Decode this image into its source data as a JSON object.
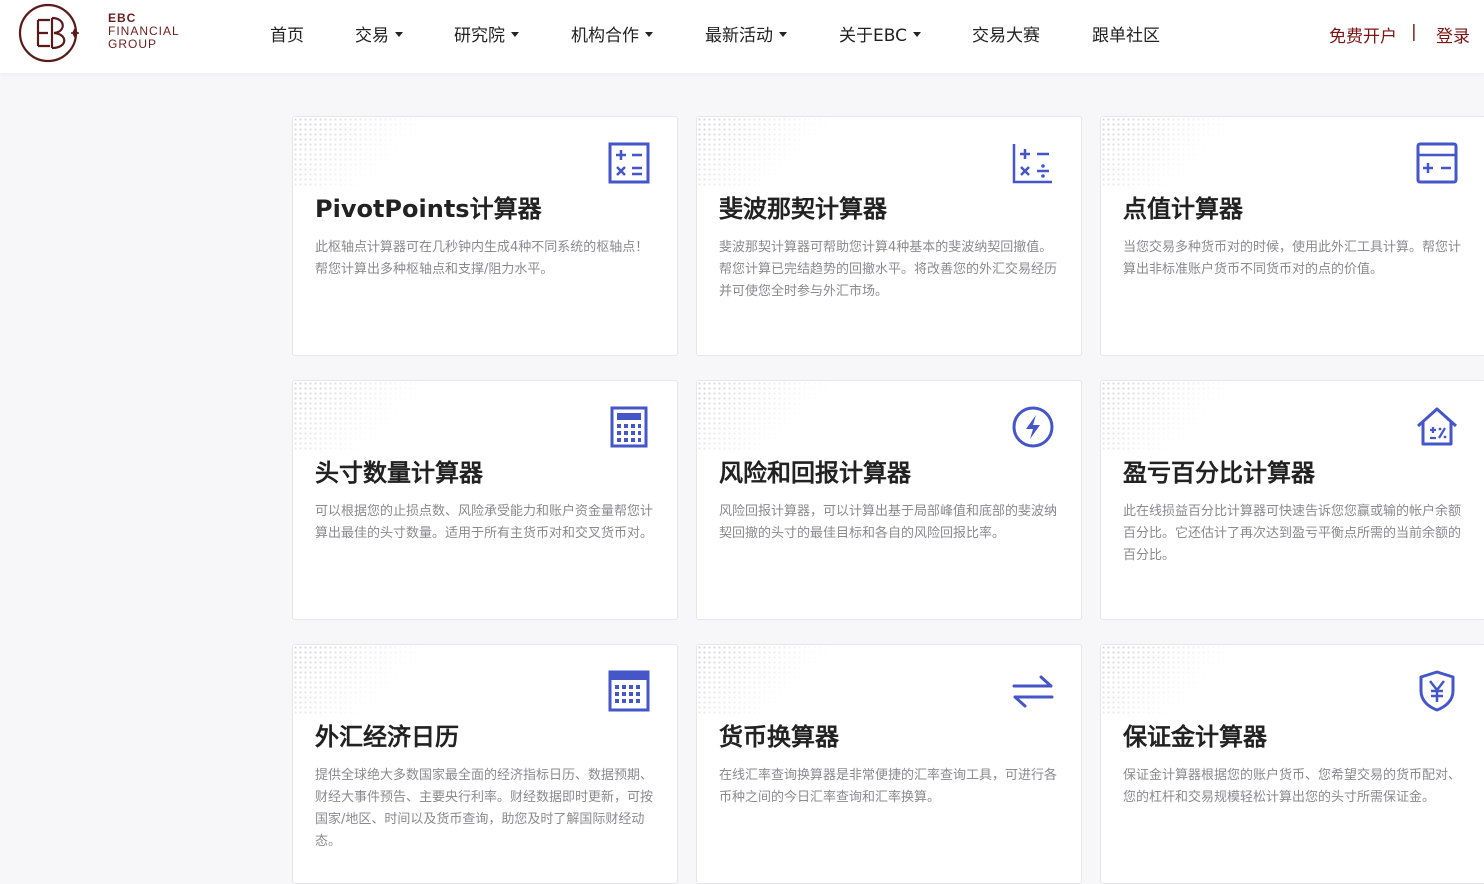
{
  "brand": {
    "line1": "EBC",
    "line2": "FINANCIAL",
    "line3": "GROUP",
    "color": "#6b1e1e"
  },
  "nav": {
    "items": [
      {
        "label": "首页",
        "dropdown": false
      },
      {
        "label": "交易",
        "dropdown": true
      },
      {
        "label": "研究院",
        "dropdown": true
      },
      {
        "label": "机构合作",
        "dropdown": true
      },
      {
        "label": "最新活动",
        "dropdown": true
      },
      {
        "label": "关于EBC",
        "dropdown": true
      },
      {
        "label": "交易大赛",
        "dropdown": false
      },
      {
        "label": "跟单社区",
        "dropdown": false
      }
    ],
    "signup": "免费开户",
    "separator": "|",
    "login": "登录"
  },
  "colors": {
    "accent": "#4556c8",
    "brand_red": "#7a1313"
  },
  "tools": [
    {
      "icon": "calculator-ops-icon",
      "title": "PivotPoints计算器",
      "desc": "此枢轴点计算器可在几秒钟内生成4种不同系统的枢轴点！帮您计算出多种枢轴点和支撑/阻力水平。"
    },
    {
      "icon": "math-symbols-icon",
      "title": "斐波那契计算器",
      "desc": "斐波那契计算器可帮助您计算4种基本的斐波纳契回撤值。帮您计算已完结趋势的回撤水平。将改善您的外汇交易经历并可使您全时参与外汇市场。"
    },
    {
      "icon": "plus-minus-card-icon",
      "title": "点值计算器",
      "desc": "当您交易多种货币对的时候，使用此外汇工具计算。帮您计算出非标准账户货币不同货币对的点的价值。"
    },
    {
      "icon": "keypad-calculator-icon",
      "title": "头寸数量计算器",
      "desc": "可以根据您的止损点数、风险承受能力和账户资金量帮您计算出最佳的头寸数量。适用于所有主货币对和交叉货币对。"
    },
    {
      "icon": "lightning-circle-icon",
      "title": "风险和回报计算器",
      "desc": "风险回报计算器，可以计算出基于局部峰值和底部的斐波纳契回撤的头寸的最佳目标和各自的风险回报比率。"
    },
    {
      "icon": "house-percent-icon",
      "title": "盈亏百分比计算器",
      "desc": "此在线损益百分比计算器可快速告诉您您赢或输的帐户余额百分比。它还估计了再次达到盈亏平衡点所需的当前余额的百分比。"
    },
    {
      "icon": "calendar-grid-icon",
      "title": "外汇经济日历",
      "desc": "提供全球绝大多数国家最全面的经济指标日历、数据预期、财经大事件预告、主要央行利率。财经数据即时更新，可按国家/地区、时间以及货币查询，助您及时了解国际财经动态。"
    },
    {
      "icon": "swap-arrows-icon",
      "title": "货币换算器",
      "desc": "在线汇率查询换算器是非常便捷的汇率查询工具，可进行各币种之间的今日汇率查询和汇率换算。"
    },
    {
      "icon": "yen-shield-icon",
      "title": "保证金计算器",
      "desc": "保证金计算器根据您的账户货币、您希望交易的货币配对、您的杠杆和交易规模轻松计算出您的头寸所需保证金。"
    }
  ]
}
